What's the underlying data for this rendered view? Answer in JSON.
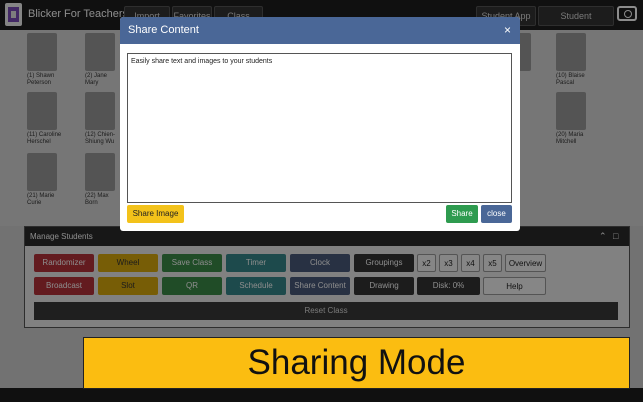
{
  "app": {
    "title": "Blicker For Teachers"
  },
  "topbar": {
    "buttons": [
      "Import Class",
      "Favorites",
      "Class Notes",
      "Student App",
      "Student Response"
    ],
    "camera_icon": "camera-icon"
  },
  "students": [
    {
      "line1": "(1) Shawn",
      "line2": "Peterson"
    },
    {
      "line1": "(2) Jane",
      "line2": "Mary"
    },
    {
      "line1": "(11) Caroline",
      "line2": "Herschel"
    },
    {
      "line1": "(12) Chien-",
      "line2": "Shiung Wu"
    },
    {
      "line1": "(21) Marie",
      "line2": "Curie"
    },
    {
      "line1": "(22) Max",
      "line2": "Born"
    },
    {
      "line1": "(10) Blaise",
      "line2": "Pascal"
    },
    {
      "line1": "(20) Maria",
      "line2": "Mitchell"
    }
  ],
  "panel": {
    "title": "Manage Students",
    "buttons": {
      "randomizer": "Randomizer",
      "wheel": "Wheel",
      "save_class": "Save Class",
      "timer": "Timer",
      "clock": "Clock",
      "groupings": "Groupings",
      "x2": "x2",
      "x3": "x3",
      "x4": "x4",
      "x5": "x5",
      "overview": "Overview",
      "broadcast": "Broadcast",
      "slot": "Slot",
      "qr": "QR",
      "schedule": "Schedule",
      "share_content": "Share Content",
      "drawing": "Drawing",
      "disk": "Disk: 0%",
      "help": "Help",
      "reset_class": "Reset Class"
    }
  },
  "banner": {
    "text": "Sharing Mode"
  },
  "modal": {
    "title": "Share Content",
    "close_symbol": "×",
    "editor_text": "Easily share text and images to your students",
    "share_image": "Share Image",
    "share": "Share",
    "close": "close"
  },
  "colors": {
    "modal_header": "#4a6797",
    "banner": "#fbbd11",
    "share_green": "#2e9b4f",
    "share_image_yellow": "#f3c21a"
  }
}
